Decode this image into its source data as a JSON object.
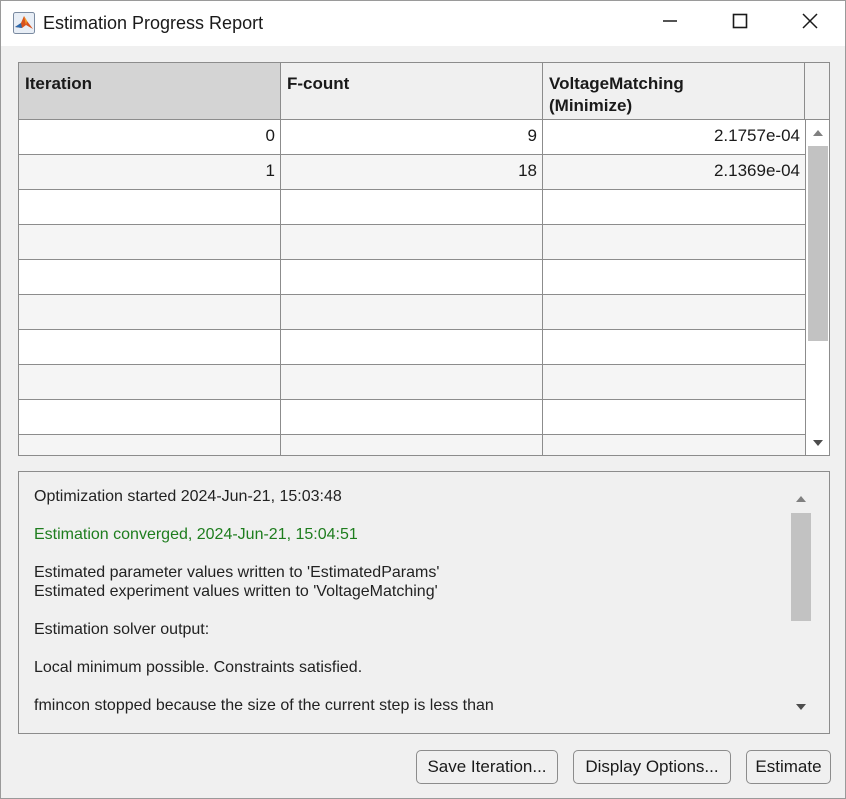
{
  "window": {
    "title": "Estimation Progress Report",
    "icons": {
      "app": "matlab-logo-icon",
      "minimize": "minimize-icon",
      "maximize": "maximize-icon",
      "close": "close-icon"
    }
  },
  "table": {
    "headers": [
      "Iteration",
      "F-count",
      "VoltageMatching (Minimize)"
    ],
    "header_lines": {
      "c2_line1": "VoltageMatching",
      "c2_line2": "(Minimize)"
    },
    "rows": [
      [
        "0",
        "9",
        "2.1757e-04"
      ],
      [
        "1",
        "18",
        "2.1369e-04"
      ],
      [
        "",
        "",
        ""
      ],
      [
        "",
        "",
        ""
      ],
      [
        "",
        "",
        ""
      ],
      [
        "",
        "",
        ""
      ],
      [
        "",
        "",
        ""
      ],
      [
        "",
        "",
        ""
      ],
      [
        "",
        "",
        ""
      ],
      [
        "",
        "",
        ""
      ]
    ]
  },
  "log": {
    "lines": [
      "Optimization started 2024-Jun-21, 15:03:48",
      "Estimation converged, 2024-Jun-21, 15:04:51",
      "Estimated parameter values written to 'EstimatedParams'",
      "Estimated experiment values written to 'VoltageMatching'",
      "Estimation solver output:",
      "Local minimum possible. Constraints satisfied.",
      "fmincon stopped because the size of the current step is less than"
    ],
    "converged_color": "#1e7d1e"
  },
  "buttons": {
    "save_iteration": "Save Iteration...",
    "display_options": "Display Options...",
    "estimate": "Estimate"
  }
}
